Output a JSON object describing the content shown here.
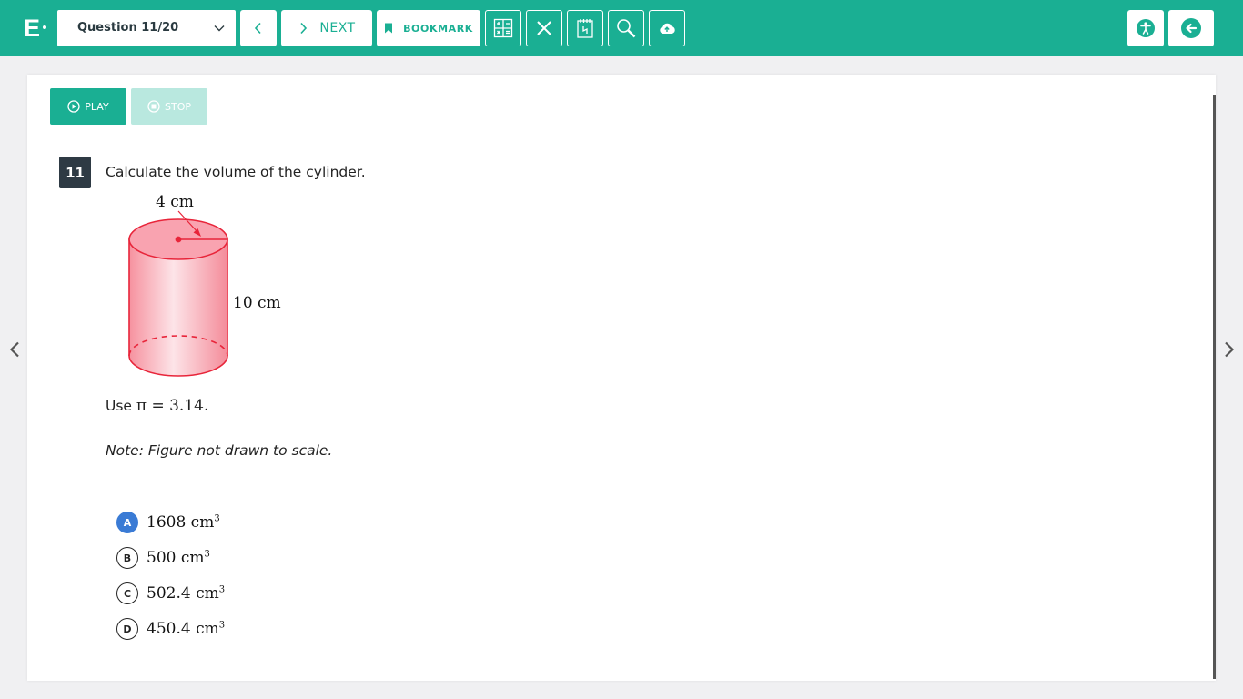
{
  "app": {
    "logo_text": "E"
  },
  "toolbar": {
    "question_select": "Question 11/20",
    "next_label": "NEXT",
    "bookmark_label": "BOOKMARK"
  },
  "media": {
    "play_label": "PLAY",
    "stop_label": "STOP"
  },
  "question": {
    "number": "11",
    "text": "Calculate the volume of the cylinder.",
    "figure": {
      "radius_label": "4 cm",
      "height_label": "10 cm"
    },
    "pi_prefix": "Use ",
    "pi_math": "π = 3.14.",
    "note": "Note: Figure not drawn to scale."
  },
  "options": [
    {
      "letter": "A",
      "value": "1608  cm",
      "exp": "3",
      "selected": true
    },
    {
      "letter": "B",
      "value": "500 cm",
      "exp": "3",
      "selected": false
    },
    {
      "letter": "C",
      "value": "502.4 cm",
      "exp": "3",
      "selected": false
    },
    {
      "letter": "D",
      "value": "450.4 cm",
      "exp": "3",
      "selected": false
    }
  ],
  "colors": {
    "brand": "#1aaf93",
    "selected_option": "#3a7bd5",
    "figure_fill": "#f9a3b0",
    "figure_stroke": "#e8253a"
  }
}
